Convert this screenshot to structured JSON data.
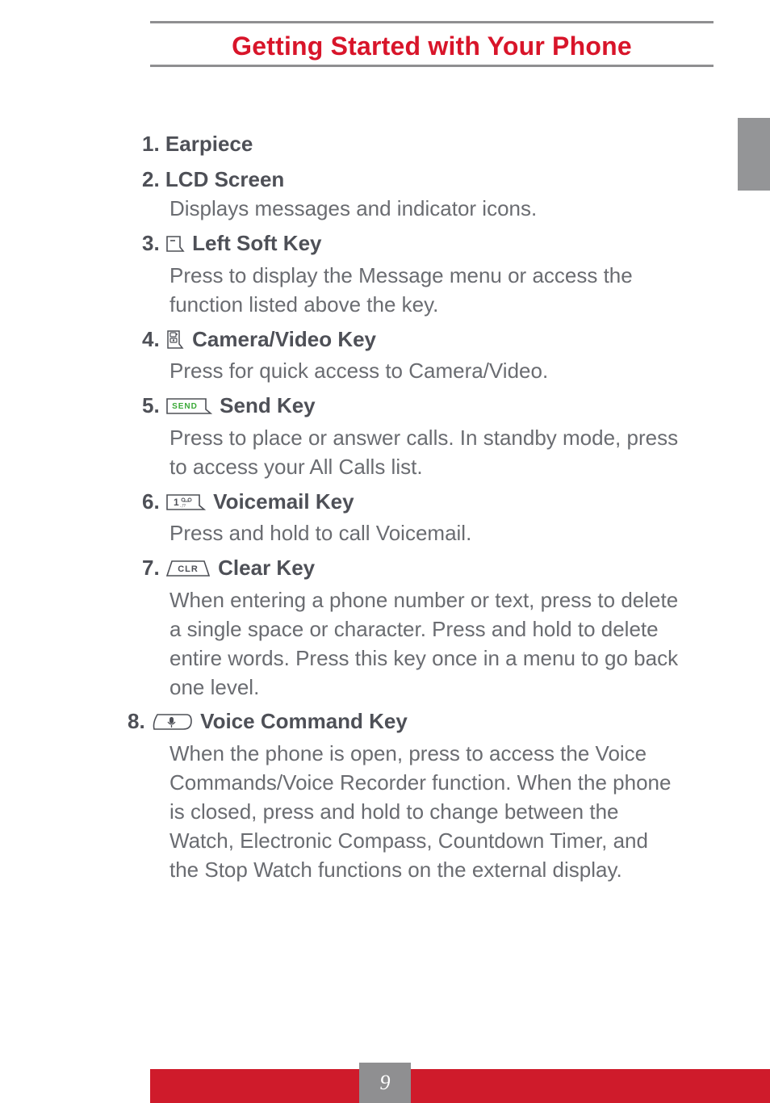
{
  "header": {
    "title": "Getting Started with Your Phone"
  },
  "items": [
    {
      "num": "1.",
      "icon": null,
      "title": "Earpiece",
      "desc": null
    },
    {
      "num": "2.",
      "icon": null,
      "title": "LCD Screen",
      "desc": "Displays messages and indicator icons."
    },
    {
      "num": "3.",
      "icon": "left-soft-key-icon",
      "title": " Left Soft Key",
      "desc": "Press to display the Message menu or access the function listed above the key."
    },
    {
      "num": "4.",
      "icon": "camera-video-key-icon",
      "title": " Camera/Video Key",
      "desc": "Press for quick access to Camera/Video."
    },
    {
      "num": "5.",
      "icon": "send-key-icon",
      "title": " Send Key",
      "desc": "Press to place or answer calls. In standby mode, press to access your All Calls list."
    },
    {
      "num": "6.",
      "icon": "voicemail-key-icon",
      "title": " Voicemail Key",
      "desc": "Press and hold to call Voicemail."
    },
    {
      "num": "7.",
      "icon": "clear-key-icon",
      "title": " Clear Key",
      "desc": "When entering a phone number or text, press to delete a single space or character. Press and hold to delete entire words. Press this key once in a menu to go back one level."
    },
    {
      "num": "8.",
      "icon": "voice-command-key-icon",
      "title": " Voice Command Key",
      "desc": "When the phone is open, press to access the Voice Commands/Voice Recorder function. When the phone is closed, press and hold to change between the Watch, Electronic Compass, Countdown Timer, and the Stop Watch functions on the external display."
    }
  ],
  "pageNumber": "9",
  "icons": {
    "left-soft-key-icon": "left-soft",
    "camera-video-key-icon": "camera",
    "send-key-icon": "SEND",
    "voicemail-key-icon": "voicemail",
    "clear-key-icon": "CLR",
    "voice-command-key-icon": "mic"
  }
}
